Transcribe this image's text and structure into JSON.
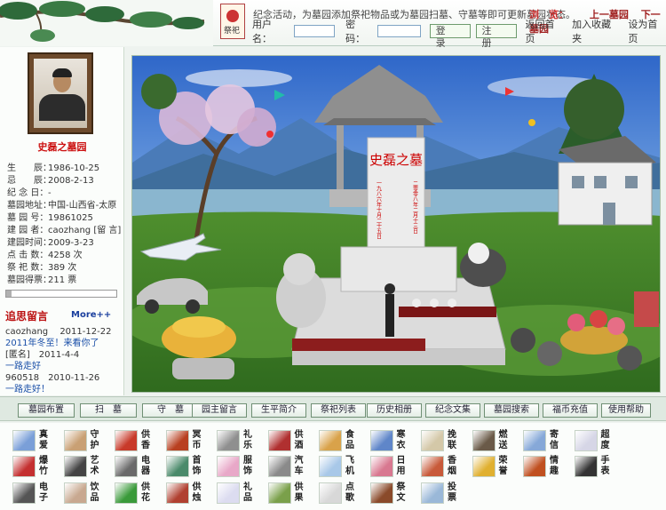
{
  "header": {
    "seal_text": "祭祀",
    "notice": "纪念活动，为墓园添加祭祀物品或为墓园扫墓、守墓等即可更新墓园状态。",
    "browse_label": "浏　览：",
    "prev_link": "上一墓园",
    "next_link": "下一墓园",
    "username_label": "用户名：",
    "password_label": "密码：",
    "login_button": "登　录",
    "register_button": "注　册",
    "home_link": "返回首页",
    "favorite_link": "加入收藏夹",
    "sethome_link": "设为首页"
  },
  "profile": {
    "memorial_name": "史磊之墓园",
    "rows": [
      {
        "k": "生　　辰：",
        "v": "1986-10-25"
      },
      {
        "k": "忌　　辰：",
        "v": "2008-2-13"
      },
      {
        "k": "纪 念 日：",
        "v": "-"
      },
      {
        "k": "墓园地址：",
        "v": "中国-山西省-太原"
      },
      {
        "k": "墓 园 号：",
        "v": "19861025"
      },
      {
        "k": "建 园 者：",
        "v": "caozhang [留 言]"
      },
      {
        "k": "建园时间：",
        "v": "2009-3-23"
      },
      {
        "k": "点 击 数：",
        "v": "4258 次"
      },
      {
        "k": "祭 祀 数：",
        "v": "389 次"
      },
      {
        "k": "墓园得票：",
        "v": "211 票"
      }
    ],
    "vote_fraction": 0.05
  },
  "messages": {
    "title": "追思留言",
    "more": "More++",
    "items": [
      {
        "meta": "caozhang　 2011-12-22",
        "body": "2011年冬至！来看你了"
      },
      {
        "meta": "[匿名]　2011-4-4",
        "body": "一路走好"
      },
      {
        "meta": "960518　2010-11-26",
        "body": "一路走好！"
      }
    ]
  },
  "scene": {
    "tomb_title": "史磊之墓",
    "tomb_left": "一九八六年十月二十五日",
    "tomb_right": "二零零八年二月十三日"
  },
  "nav": [
    "墓园布置",
    "扫　墓",
    "守　墓",
    "园主留言",
    "生平简介",
    "祭祀列表",
    "历史相册",
    "纪念文集",
    "墓园搜索",
    "福币充值",
    "使用帮助"
  ],
  "offerings": [
    {
      "label": "真爱",
      "color": "#7a9fd8"
    },
    {
      "label": "守护",
      "color": "#c9a074"
    },
    {
      "label": "供香",
      "color": "#c83a2a"
    },
    {
      "label": "冥币",
      "color": "#b84020"
    },
    {
      "label": "礼乐",
      "color": "#8f8f8f"
    },
    {
      "label": "供酒",
      "color": "#b03030"
    },
    {
      "label": "食品",
      "color": "#d9a24a"
    },
    {
      "label": "寒衣",
      "color": "#5f86c9"
    },
    {
      "label": "挽联",
      "color": "#d4c8a8"
    },
    {
      "label": "燃送",
      "color": "#6a5a48"
    },
    {
      "label": "寄信",
      "color": "#86a8d8"
    },
    {
      "label": "超度",
      "color": "#d6d6e6"
    },
    {
      "label": "爆竹",
      "color": "#c43030"
    },
    {
      "label": "艺术",
      "color": "#444444"
    },
    {
      "label": "电器",
      "color": "#6a6a6a"
    },
    {
      "label": "首饰",
      "color": "#4a8a6a"
    },
    {
      "label": "服饰",
      "color": "#e8a8c8"
    },
    {
      "label": "汽车",
      "color": "#8a8a8a"
    },
    {
      "label": "飞机",
      "color": "#a8c8e8"
    },
    {
      "label": "日用",
      "color": "#d87890"
    },
    {
      "label": "香烟",
      "color": "#c85a3a"
    },
    {
      "label": "荣誉",
      "color": "#e0b030"
    },
    {
      "label": "情趣",
      "color": "#c05020"
    },
    {
      "label": "手表",
      "color": "#333333"
    },
    {
      "label": "电子",
      "color": "#555555"
    },
    {
      "label": "饮品",
      "color": "#c8a890"
    },
    {
      "label": "供花",
      "color": "#3a9a3a"
    },
    {
      "label": "供烛",
      "color": "#b04030"
    },
    {
      "label": "礼品",
      "color": "#dcdcf0"
    },
    {
      "label": "供果",
      "color": "#7aa04a"
    },
    {
      "label": "点歌",
      "color": "#d8d8d8"
    },
    {
      "label": "祭文",
      "color": "#8a4a2a"
    },
    {
      "label": "投票",
      "color": "#9ab8d8"
    }
  ]
}
